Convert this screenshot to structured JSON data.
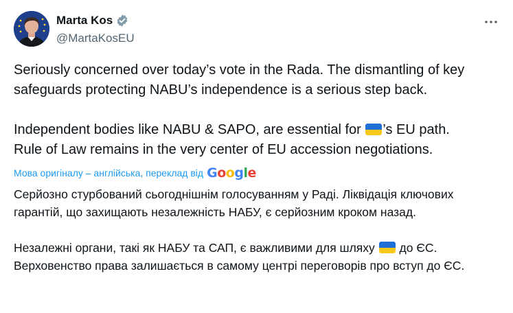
{
  "author": {
    "display_name": "Marta Kos",
    "handle": "@MartaKosEU",
    "verified": true
  },
  "tweet": {
    "original_paragraph_1": "Seriously concerned over today’s vote in the Rada. The dismantling of key safeguards protecting NABU’s independence is a serious step back.",
    "original_paragraph_2_part_1": "Independent bodies like NABU & SAPO, are essential for ",
    "original_paragraph_2_part_2": "’s EU path.",
    "original_paragraph_3": "Rule of Law remains in the very center of EU accession negotiations.",
    "translation_note": "Мова оригіналу – англійська, переклад від",
    "translation_provider": "Google",
    "translated_paragraph_1": "Серйозно стурбований сьогоднішнім голосуванням у Раді. Ліквідація ключових гарантій, що захищають незалежність НАБУ, є серйозним кроком назад.",
    "translated_paragraph_2_part_1": "Незалежні органи, такі як НАБУ та САП, є важливими для шляху ",
    "translated_paragraph_2_part_2": " до ЄС. Верховенство права залишається в самому центрі переговорів про вступ до ЄС."
  },
  "icons": {
    "verified": "verified-badge-icon",
    "more": "more-options-icon",
    "flag": "ukraine-flag-emoji"
  },
  "colors": {
    "text": "#0f1419",
    "secondary_text": "#536471",
    "accent": "#1d9bf0",
    "flag_blue": "#1f6fd6",
    "flag_yellow": "#f7c91d"
  }
}
